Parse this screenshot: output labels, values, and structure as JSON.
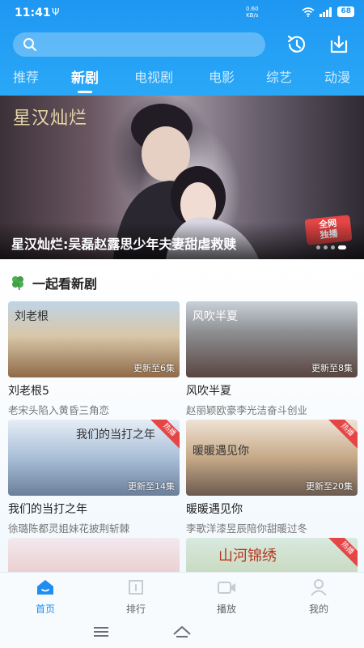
{
  "status_bar": {
    "time": "11:41",
    "usb_glyph": "Ψ",
    "net_speed_value": "0.60",
    "net_speed_unit": "KB/s",
    "battery": "68"
  },
  "header": {
    "search_placeholder": "",
    "tabs": [
      {
        "label": "推荐",
        "active": false
      },
      {
        "label": "新剧",
        "active": true
      },
      {
        "label": "电视剧",
        "active": false
      },
      {
        "label": "电影",
        "active": false
      },
      {
        "label": "综艺",
        "active": false
      },
      {
        "label": "动漫",
        "active": false
      }
    ]
  },
  "banner": {
    "logo_text": "星汉灿烂",
    "badge_line1": "全网",
    "badge_line2": "独播",
    "caption": "星汉灿烂:吴磊赵露思少年夫妻甜虐救赎"
  },
  "section": {
    "title": "一起看新剧",
    "cards": [
      {
        "title": "刘老根5",
        "desc": "老宋头陷入黄昏三角恋",
        "episode": "更新至6集",
        "art": "刘老根",
        "hot": ""
      },
      {
        "title": "风吹半夏",
        "desc": "赵丽颖欧豪李光洁奋斗创业",
        "episode": "更新至8集",
        "art": "风吹半夏",
        "hot": ""
      },
      {
        "title": "我们的当打之年",
        "desc": "徐璐陈都灵姐妹花披荆斩棘",
        "episode": "更新至14集",
        "art": "我们的当打之年",
        "hot": "热播"
      },
      {
        "title": "暖暖遇见你",
        "desc": "李歌洋漆昱辰陪你甜暖过冬",
        "episode": "更新至20集",
        "art": "暖暖遇见你",
        "hot": "热播"
      },
      {
        "title": "",
        "desc": "",
        "episode": "",
        "art": "",
        "hot": ""
      },
      {
        "title": "",
        "desc": "",
        "episode": "",
        "art": "山河锦绣",
        "hot": "热播"
      }
    ]
  },
  "bottom_nav": [
    {
      "label": "首页",
      "icon": "home-icon",
      "active": true
    },
    {
      "label": "排行",
      "icon": "ranking-icon",
      "active": false
    },
    {
      "label": "播放",
      "icon": "video-icon",
      "active": false
    },
    {
      "label": "我的",
      "icon": "user-icon",
      "active": false
    }
  ],
  "colors": {
    "brand_blue": "#1e97f2",
    "accent_active": "#1e8ef0",
    "hot_badge": "#e64545"
  }
}
